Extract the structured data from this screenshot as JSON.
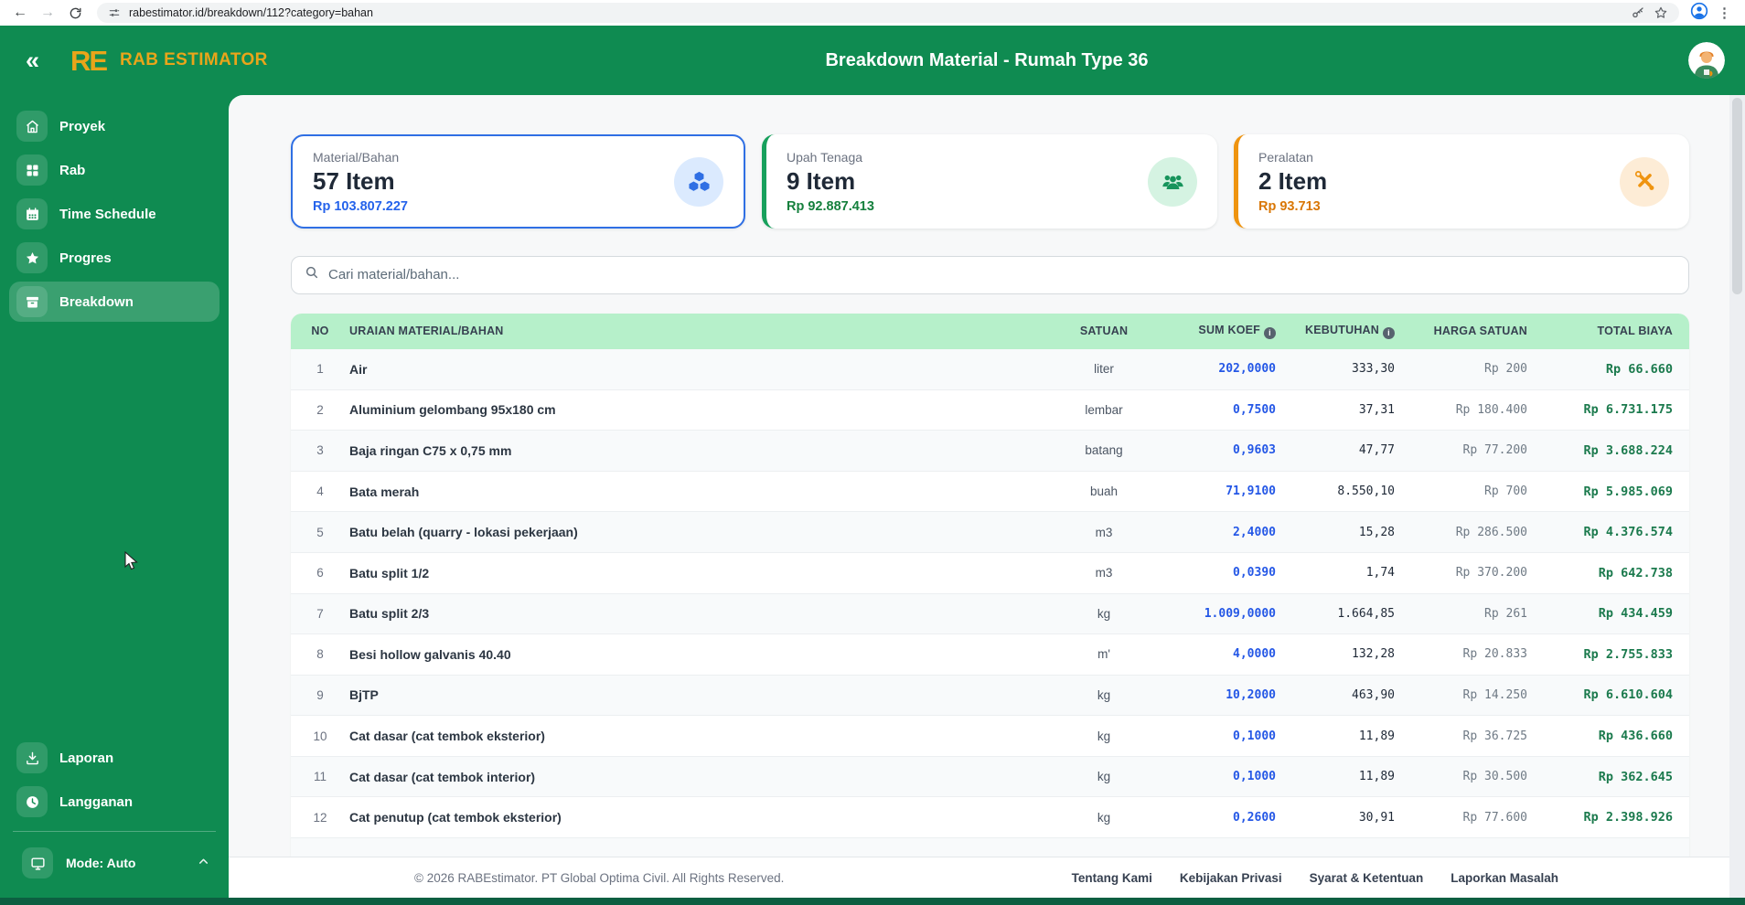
{
  "browser": {
    "url": "rabestimator.id/breakdown/112?category=bahan"
  },
  "header": {
    "logo_text": "RE",
    "brand": "RAB ESTIMATOR",
    "title": "Breakdown Material - Rumah Type 36"
  },
  "sidebar": {
    "items": [
      {
        "label": "Proyek",
        "icon": "home-icon",
        "active": false
      },
      {
        "label": "Rab",
        "icon": "grid-icon",
        "active": false
      },
      {
        "label": "Time Schedule",
        "icon": "calendar-icon",
        "active": false
      },
      {
        "label": "Progres",
        "icon": "star-icon",
        "active": false
      },
      {
        "label": "Breakdown",
        "icon": "archive-icon",
        "active": true
      }
    ],
    "bottom_items": [
      {
        "label": "Laporan",
        "icon": "download-icon"
      },
      {
        "label": "Langganan",
        "icon": "clock-icon"
      }
    ],
    "mode_label": "Mode: Auto"
  },
  "cards": [
    {
      "label": "Material/Bahan",
      "count": "57 Item",
      "amount": "Rp 103.807.227",
      "accent": "#2f6fe4",
      "icon": "cubes-icon",
      "selected": true
    },
    {
      "label": "Upah Tenaga",
      "count": "9 Item",
      "amount": "Rp 92.887.413",
      "accent": "#17a05c",
      "icon": "users-icon",
      "selected": false
    },
    {
      "label": "Peralatan",
      "count": "2 Item",
      "amount": "Rp 93.713",
      "accent": "#ef9410",
      "icon": "tools-icon",
      "selected": false
    }
  ],
  "search": {
    "placeholder": "Cari material/bahan..."
  },
  "table": {
    "columns": {
      "no": "NO",
      "uraian": "URAIAN MATERIAL/BAHAN",
      "satuan": "SATUAN",
      "sum_koef": "SUM KOEF",
      "kebutuhan": "KEBUTUHAN",
      "harga_satuan": "HARGA SATUAN",
      "total_biaya": "TOTAL BIAYA"
    },
    "rows": [
      {
        "no": "1",
        "uraian": "Air",
        "satuan": "liter",
        "sum_koef": "202,0000",
        "kebutuhan": "333,30",
        "harga": "Rp 200",
        "total": "Rp 66.660"
      },
      {
        "no": "2",
        "uraian": "Aluminium gelombang 95x180 cm",
        "satuan": "lembar",
        "sum_koef": "0,7500",
        "kebutuhan": "37,31",
        "harga": "Rp 180.400",
        "total": "Rp 6.731.175"
      },
      {
        "no": "3",
        "uraian": "Baja ringan C75 x 0,75 mm",
        "satuan": "batang",
        "sum_koef": "0,9603",
        "kebutuhan": "47,77",
        "harga": "Rp 77.200",
        "total": "Rp 3.688.224"
      },
      {
        "no": "4",
        "uraian": "Bata merah",
        "satuan": "buah",
        "sum_koef": "71,9100",
        "kebutuhan": "8.550,10",
        "harga": "Rp 700",
        "total": "Rp 5.985.069"
      },
      {
        "no": "5",
        "uraian": "Batu belah (quarry - lokasi pekerjaan)",
        "satuan": "m3",
        "sum_koef": "2,4000",
        "kebutuhan": "15,28",
        "harga": "Rp 286.500",
        "total": "Rp 4.376.574"
      },
      {
        "no": "6",
        "uraian": "Batu split 1/2",
        "satuan": "m3",
        "sum_koef": "0,0390",
        "kebutuhan": "1,74",
        "harga": "Rp 370.200",
        "total": "Rp 642.738"
      },
      {
        "no": "7",
        "uraian": "Batu split 2/3",
        "satuan": "kg",
        "sum_koef": "1.009,0000",
        "kebutuhan": "1.664,85",
        "harga": "Rp 261",
        "total": "Rp 434.459"
      },
      {
        "no": "8",
        "uraian": "Besi hollow galvanis 40.40",
        "satuan": "m'",
        "sum_koef": "4,0000",
        "kebutuhan": "132,28",
        "harga": "Rp 20.833",
        "total": "Rp 2.755.833"
      },
      {
        "no": "9",
        "uraian": "BjTP",
        "satuan": "kg",
        "sum_koef": "10,2000",
        "kebutuhan": "463,90",
        "harga": "Rp 14.250",
        "total": "Rp 6.610.604"
      },
      {
        "no": "10",
        "uraian": "Cat dasar (cat tembok eksterior)",
        "satuan": "kg",
        "sum_koef": "0,1000",
        "kebutuhan": "11,89",
        "harga": "Rp 36.725",
        "total": "Rp 436.660"
      },
      {
        "no": "11",
        "uraian": "Cat dasar (cat tembok interior)",
        "satuan": "kg",
        "sum_koef": "0,1000",
        "kebutuhan": "11,89",
        "harga": "Rp 30.500",
        "total": "Rp 362.645"
      },
      {
        "no": "12",
        "uraian": "Cat penutup (cat tembok eksterior)",
        "satuan": "kg",
        "sum_koef": "0,2600",
        "kebutuhan": "30,91",
        "harga": "Rp 77.600",
        "total": "Rp 2.398.926"
      }
    ]
  },
  "footer": {
    "copyright": "© 2026 RABEstimator. PT Global Optima Civil. All Rights Reserved.",
    "links": [
      "Tentang Kami",
      "Kebijakan Privasi",
      "Syarat & Ketentuan",
      "Laporkan Masalah"
    ]
  },
  "colors": {
    "primary_green": "#0f8b51",
    "brand_yellow": "#e9a51a",
    "table_header_green": "#b6f0ca",
    "koef_blue": "#2457e6",
    "total_green": "#1b7a4d",
    "card_blue": "#2f6fe4",
    "card_green": "#17a05c",
    "card_orange": "#ef9410"
  }
}
